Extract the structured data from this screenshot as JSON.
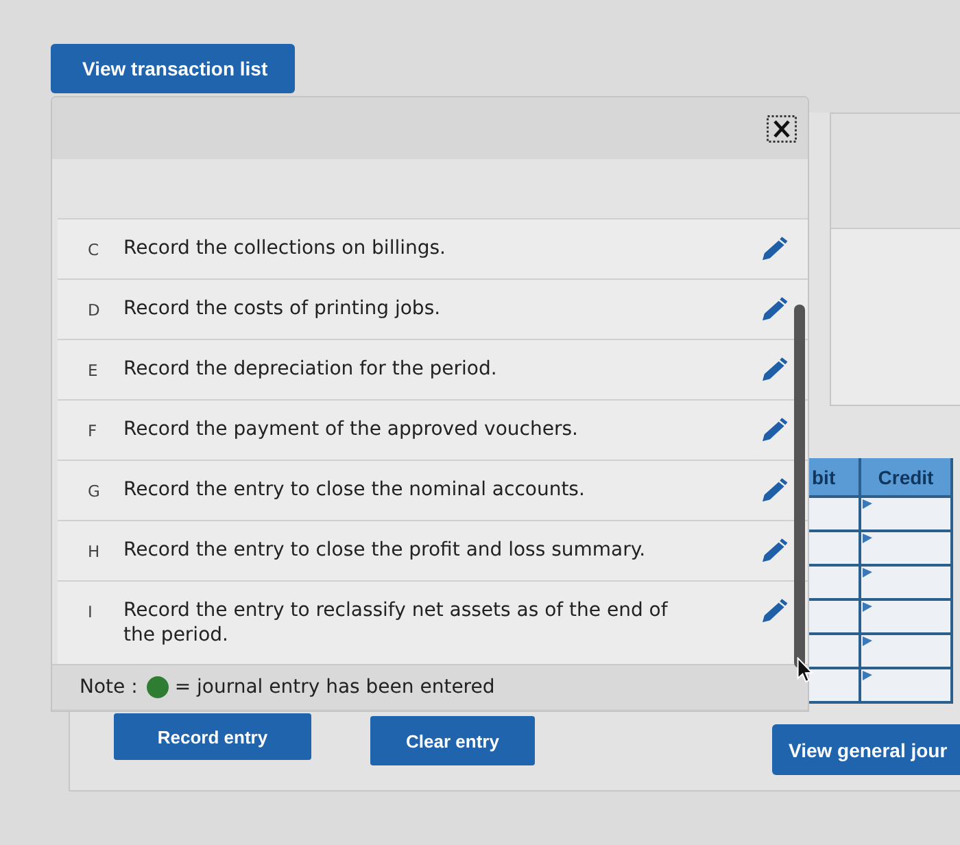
{
  "transaction_list_button": {
    "label": "View transaction list"
  },
  "transactions": [
    {
      "letter": "C",
      "description": "Record the collections on billings."
    },
    {
      "letter": "D",
      "description": "Record the costs of printing jobs."
    },
    {
      "letter": "E",
      "description": "Record the depreciation for the period."
    },
    {
      "letter": "F",
      "description": "Record the payment of the approved vouchers."
    },
    {
      "letter": "G",
      "description": "Record the entry to close the nominal accounts."
    },
    {
      "letter": "H",
      "description": "Record the entry to close the profit and loss summary."
    },
    {
      "letter": "I",
      "description": "Record the entry to reclassify net assets as of the end of the period."
    }
  ],
  "note": {
    "label": "Note :",
    "text": "= journal entry has been entered"
  },
  "journal_table": {
    "columns": [
      "bit",
      "Credit"
    ],
    "rows": [
      {
        "kind": "entry"
      },
      {
        "kind": "entry"
      },
      {
        "kind": "entry"
      },
      {
        "kind": "entry"
      },
      {
        "kind": "entry"
      },
      {
        "kind": "entry"
      }
    ]
  },
  "actions": [
    "Record entry",
    "Clear entry",
    "View general jour"
  ]
}
